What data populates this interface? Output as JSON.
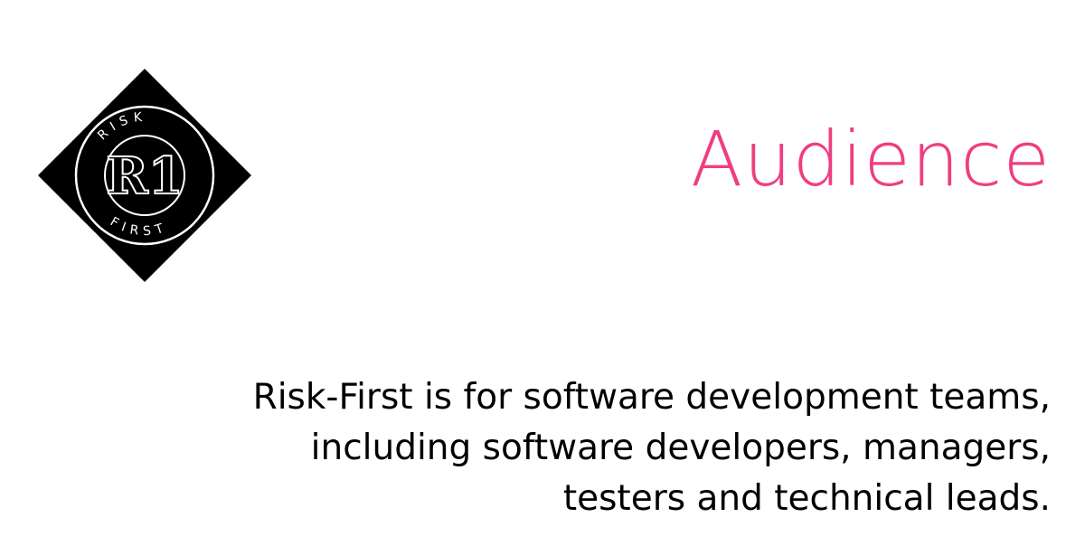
{
  "logo": {
    "monogram": "R1",
    "ring_top": "RISK",
    "ring_bottom": "FIRST",
    "colors": {
      "fill": "#000000",
      "line": "#ffffff"
    }
  },
  "heading": "Audience",
  "body": "Risk-First is for software development teams, including software developers, managers, testers and technical leads.",
  "colors": {
    "accent": "#ef3e81",
    "text": "#000000",
    "background": "#ffffff"
  }
}
